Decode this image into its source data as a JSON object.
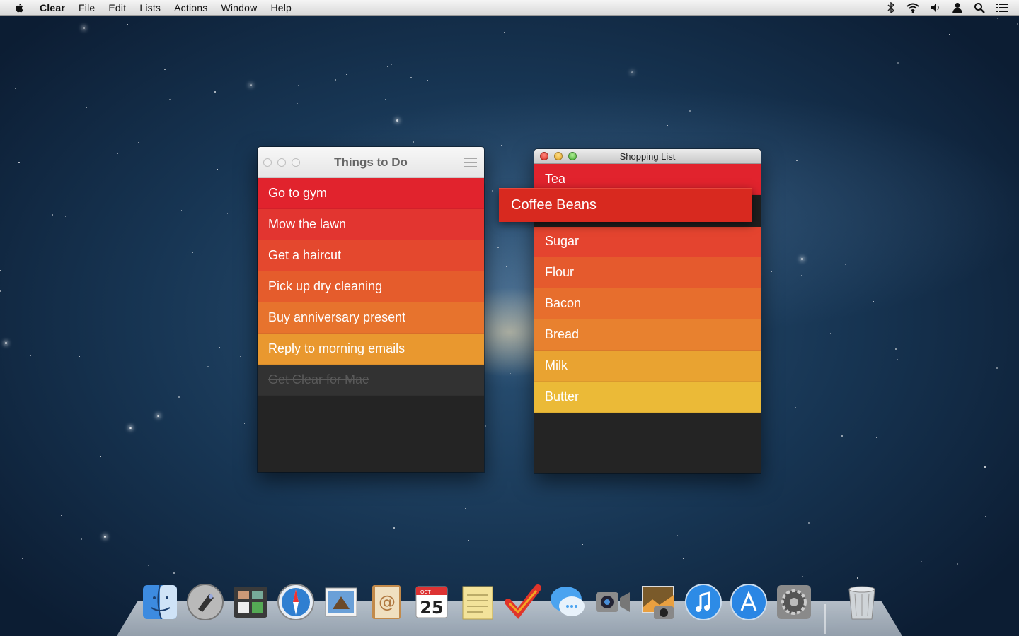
{
  "menubar": {
    "apple_icon": "apple-icon",
    "app_name": "Clear",
    "items": [
      "File",
      "Edit",
      "Lists",
      "Actions",
      "Window",
      "Help"
    ],
    "status_icons": [
      "bluetooth-icon",
      "wifi-icon",
      "volume-icon",
      "user-icon",
      "spotlight-icon",
      "notification-center-icon"
    ]
  },
  "things_window": {
    "title": "Things to Do",
    "items": [
      {
        "label": "Go to gym",
        "color": "#e1232d",
        "done": false
      },
      {
        "label": "Mow the lawn",
        "color": "#e23530",
        "done": false
      },
      {
        "label": "Get a haircut",
        "color": "#e4482e",
        "done": false
      },
      {
        "label": "Pick up dry cleaning",
        "color": "#e55c2c",
        "done": false
      },
      {
        "label": "Buy anniversary present",
        "color": "#e7732d",
        "done": false
      },
      {
        "label": "Reply to morning emails",
        "color": "#e9982f",
        "done": false
      },
      {
        "label": "Get Clear for Mac",
        "color": "#323232",
        "done": true
      }
    ]
  },
  "shopping_window": {
    "title": "Shopping List",
    "items": [
      {
        "label": "Tea",
        "color": "#e1232d"
      },
      {
        "label": "Sugar",
        "color": "#e4442f"
      },
      {
        "label": "Flour",
        "color": "#e55a2d"
      },
      {
        "label": "Bacon",
        "color": "#e76e2d"
      },
      {
        "label": "Bread",
        "color": "#e8812f"
      },
      {
        "label": "Milk",
        "color": "#e9a331"
      },
      {
        "label": "Butter",
        "color": "#ebba37"
      }
    ],
    "dragged_item": "Coffee Beans"
  },
  "dock": {
    "icons": [
      {
        "name": "finder-icon",
        "color": "#3d8be0"
      },
      {
        "name": "launchpad-icon",
        "color": "#b9b9b9"
      },
      {
        "name": "mission-control-icon",
        "color": "#3a3a3a"
      },
      {
        "name": "safari-icon",
        "color": "#2f7fd1"
      },
      {
        "name": "mail-icon",
        "color": "#6aa0d8"
      },
      {
        "name": "contacts-icon",
        "color": "#c28a4a"
      },
      {
        "name": "calendar-icon",
        "color": "#ffffff"
      },
      {
        "name": "notes-icon",
        "color": "#f3e39a"
      },
      {
        "name": "clear-icon",
        "color": "#e0342a"
      },
      {
        "name": "messages-icon",
        "color": "#4aa3f0"
      },
      {
        "name": "facetime-icon",
        "color": "#8c8c8c"
      },
      {
        "name": "iphoto-icon",
        "color": "#7a5a2a"
      },
      {
        "name": "itunes-icon",
        "color": "#2d8be6"
      },
      {
        "name": "app-store-icon",
        "color": "#2a86e4"
      },
      {
        "name": "system-preferences-icon",
        "color": "#8a8a8a"
      },
      {
        "name": "trash-icon",
        "color": "#cfd4d8"
      }
    ],
    "calendar_month": "OCT",
    "calendar_day": "25"
  }
}
